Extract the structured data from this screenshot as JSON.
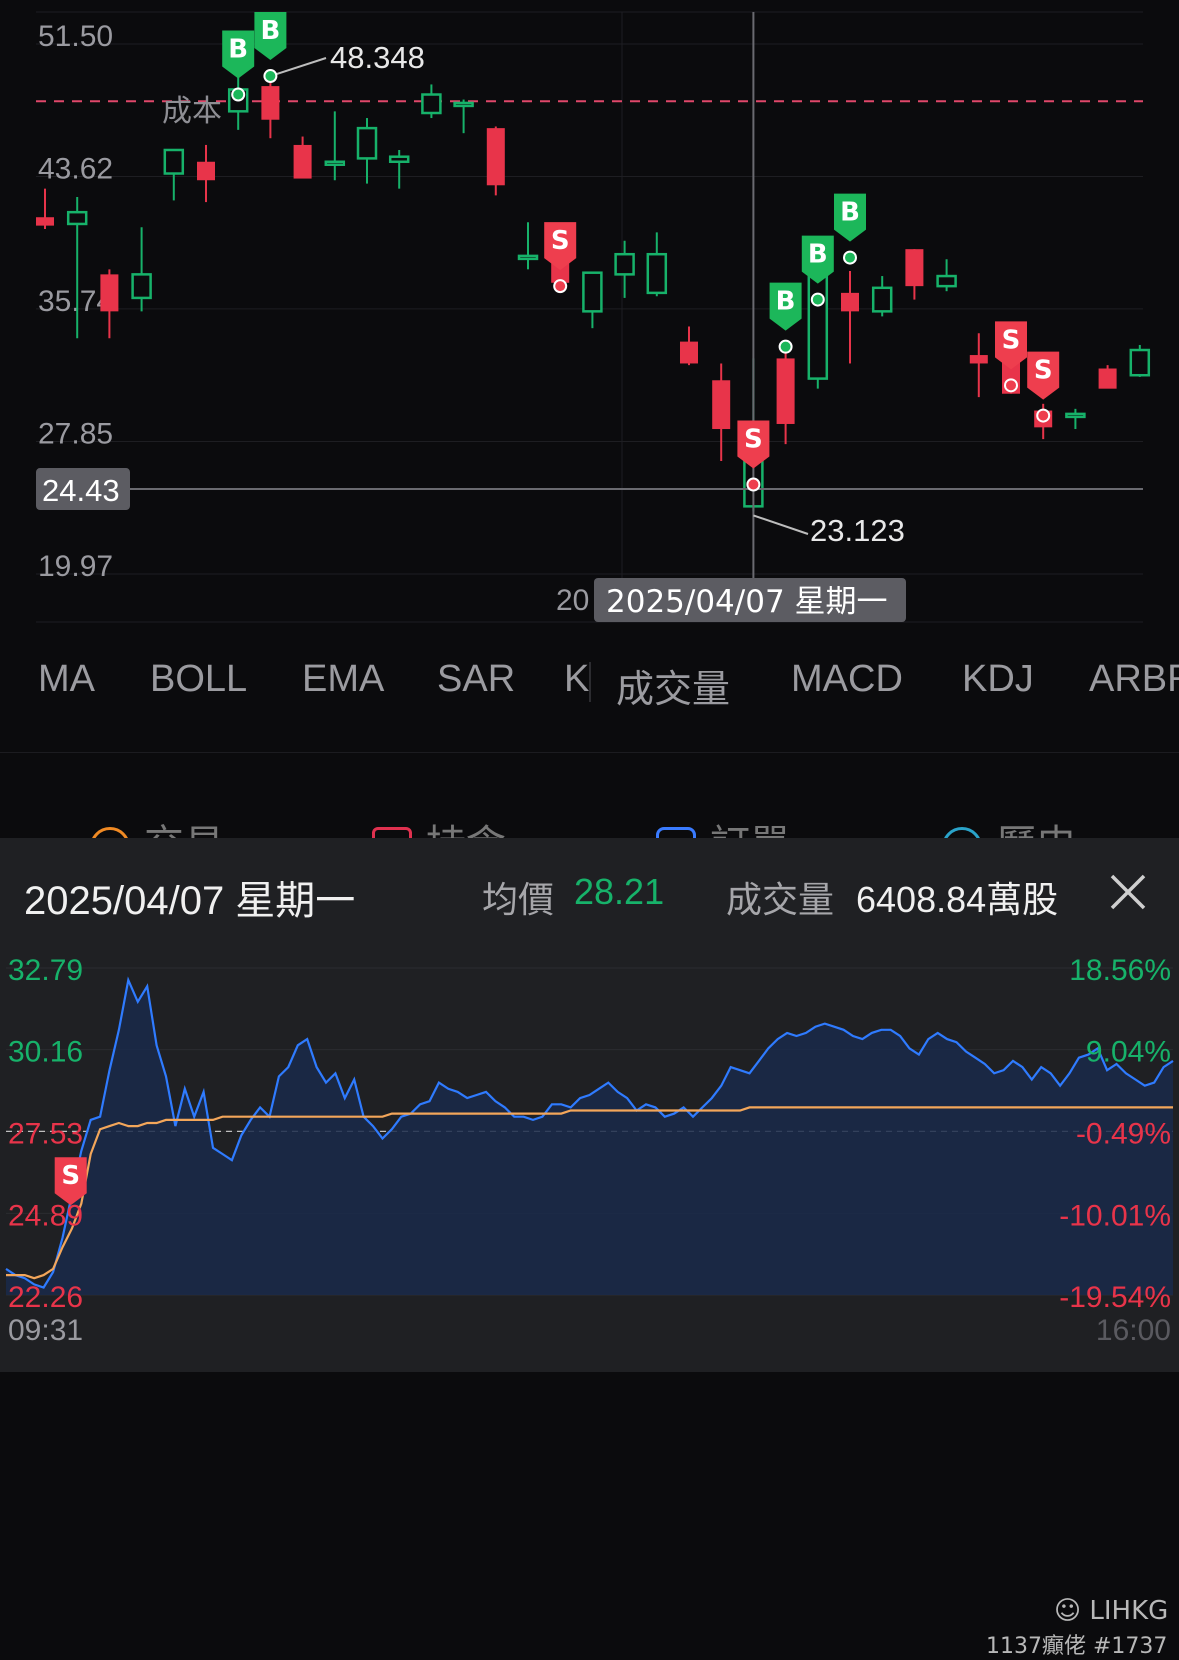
{
  "kchart": {
    "price_labels": [
      "51.50",
      "43.62",
      "35.74",
      "27.85",
      "19.97"
    ],
    "cost_label": "成本",
    "crosshair_price": "24.43",
    "crosshair_date": "2025/04/07 星期一",
    "date_label_partial": "20",
    "high_label": "48.348",
    "low_label": "23.123",
    "buy_marker": "B",
    "sell_marker": "S"
  },
  "tabs": [
    "MA",
    "BOLL",
    "EMA",
    "SAR",
    "K",
    "成交量",
    "MACD",
    "KDJ",
    "ARBR"
  ],
  "ghost_tabs": [
    {
      "label": "交易",
      "color": "#f08a24"
    },
    {
      "label": "持倉",
      "color": "#e0314f"
    },
    {
      "label": "訂單",
      "color": "#3a7bff"
    },
    {
      "label": "歷史",
      "color": "#2aa3c9"
    }
  ],
  "panel": {
    "date": "2025/04/07 星期一",
    "avg_label": "均價",
    "avg_value": "28.21",
    "volume_label": "成交量",
    "volume_value": "6408.84萬股",
    "left_axis": [
      "32.79",
      "30.16",
      "27.53",
      "24.89",
      "22.26"
    ],
    "right_axis": [
      "18.56%",
      "9.04%",
      "-0.49%",
      "-10.01%",
      "-19.54%"
    ],
    "time_start": "09:31",
    "time_end": "16:00",
    "watermark_brand": "LIHKG",
    "watermark_user": "1137癲佬 #1737"
  },
  "colors": {
    "up": "#17b26a",
    "down": "#e8344a",
    "price_line": "#2f7bff",
    "avg_line": "#f3a65a",
    "cost_line": "#e0476a",
    "background": "#0b0b0d",
    "panel_bg": "#1f2023"
  },
  "chart_data": [
    {
      "type": "candlestick",
      "title": "",
      "ylim": [
        19.97,
        51.5
      ],
      "yticks": [
        51.5,
        43.62,
        35.74,
        27.85,
        19.97
      ],
      "cost_price": 47.5,
      "crosshair": {
        "date": "2025/04/07",
        "price": 24.43
      },
      "annotations": [
        {
          "label": "48.348",
          "kind": "high"
        },
        {
          "label": "23.123",
          "kind": "low"
        }
      ],
      "candles": [
        {
          "o": 40.6,
          "h": 42.3,
          "l": 39.9,
          "c": 40.1
        },
        {
          "o": 40.2,
          "h": 41.8,
          "l": 33.4,
          "c": 40.9
        },
        {
          "o": 37.2,
          "h": 37.5,
          "l": 33.4,
          "c": 35.0
        },
        {
          "o": 35.8,
          "h": 40.0,
          "l": 35.0,
          "c": 37.2
        },
        {
          "o": 43.2,
          "h": 44.1,
          "l": 41.6,
          "c": 44.6
        },
        {
          "o": 43.9,
          "h": 44.9,
          "l": 41.5,
          "c": 42.8
        },
        {
          "o": 46.9,
          "h": 50.1,
          "l": 45.8,
          "c": 48.2
        },
        {
          "o": 48.4,
          "h": 49.0,
          "l": 45.3,
          "c": 46.4
        },
        {
          "o": 44.9,
          "h": 45.4,
          "l": 43.0,
          "c": 42.9
        },
        {
          "o": 43.9,
          "h": 46.9,
          "l": 42.8,
          "c": 43.9
        },
        {
          "o": 44.1,
          "h": 46.5,
          "l": 42.6,
          "c": 45.9
        },
        {
          "o": 43.9,
          "h": 44.6,
          "l": 42.3,
          "c": 44.2
        },
        {
          "o": 46.8,
          "h": 48.5,
          "l": 46.5,
          "c": 47.9
        },
        {
          "o": 47.4,
          "h": 47.6,
          "l": 45.6,
          "c": 47.4
        },
        {
          "o": 45.9,
          "h": 46.0,
          "l": 41.9,
          "c": 42.5
        },
        {
          "o": 38.3,
          "h": 40.3,
          "l": 37.5,
          "c": 38.3
        },
        {
          "o": 38.1,
          "h": 38.5,
          "l": 36.4,
          "c": 36.7
        },
        {
          "o": 35.0,
          "h": 37.1,
          "l": 34.0,
          "c": 37.3
        },
        {
          "o": 37.2,
          "h": 39.2,
          "l": 35.8,
          "c": 38.4
        },
        {
          "o": 36.1,
          "h": 39.7,
          "l": 35.9,
          "c": 38.4
        },
        {
          "o": 33.2,
          "h": 34.1,
          "l": 31.8,
          "c": 31.9
        },
        {
          "o": 30.9,
          "h": 31.9,
          "l": 26.1,
          "c": 28.0
        },
        {
          "o": 23.4,
          "h": 32.2,
          "l": 23.1,
          "c": 28.3
        },
        {
          "o": 32.2,
          "h": 33.2,
          "l": 27.1,
          "c": 28.3
        },
        {
          "o": 31.0,
          "h": 39.0,
          "l": 30.4,
          "c": 38.7
        },
        {
          "o": 36.1,
          "h": 37.4,
          "l": 31.9,
          "c": 35.0
        },
        {
          "o": 35.0,
          "h": 37.1,
          "l": 34.7,
          "c": 36.4
        },
        {
          "o": 38.7,
          "h": 38.7,
          "l": 35.7,
          "c": 36.5
        },
        {
          "o": 36.5,
          "h": 38.1,
          "l": 36.2,
          "c": 37.1
        },
        {
          "o": 32.4,
          "h": 33.7,
          "l": 29.9,
          "c": 31.9
        },
        {
          "o": 32.0,
          "h": 32.6,
          "l": 30.1,
          "c": 30.1
        },
        {
          "o": 29.1,
          "h": 29.5,
          "l": 27.4,
          "c": 28.1
        },
        {
          "o": 28.9,
          "h": 29.2,
          "l": 28.0,
          "c": 28.9
        },
        {
          "o": 31.6,
          "h": 31.8,
          "l": 30.6,
          "c": 30.4
        },
        {
          "o": 31.2,
          "h": 33.0,
          "l": 31.1,
          "c": 32.7
        }
      ],
      "trades": [
        {
          "candle": 6,
          "side": "B",
          "price": 47.9
        },
        {
          "candle": 7,
          "side": "B",
          "price": 49.0
        },
        {
          "candle": 16,
          "side": "S",
          "price": 36.5
        },
        {
          "candle": 22,
          "side": "S",
          "price": 24.7
        },
        {
          "candle": 23,
          "side": "B",
          "price": 32.9
        },
        {
          "candle": 24,
          "side": "B",
          "price": 35.7
        },
        {
          "candle": 25,
          "side": "B",
          "price": 38.2
        },
        {
          "candle": 30,
          "side": "S",
          "price": 30.6
        },
        {
          "candle": 31,
          "side": "S",
          "price": 28.8
        }
      ]
    },
    {
      "type": "line",
      "title": "",
      "x_range": [
        "09:31",
        "16:00"
      ],
      "ylim": [
        22.26,
        32.79
      ],
      "yticks": [
        32.79,
        30.16,
        27.53,
        24.89,
        22.26
      ],
      "pct_ticks": [
        "18.56%",
        "9.04%",
        "-0.49%",
        "-10.01%",
        "-19.54%"
      ],
      "reference": 27.53,
      "series": [
        {
          "color": "#2f7bff",
          "values": [
            23.1,
            22.9,
            22.8,
            22.6,
            22.5,
            23.0,
            24.1,
            25.5,
            26.9,
            27.9,
            28.0,
            29.5,
            30.8,
            32.4,
            31.7,
            32.2,
            30.3,
            29.3,
            27.7,
            28.9,
            28.0,
            28.8,
            27.0,
            26.8,
            26.6,
            27.4,
            27.9,
            28.3,
            28.0,
            29.3,
            29.6,
            30.3,
            30.5,
            29.6,
            29.1,
            29.4,
            28.6,
            29.2,
            28.0,
            27.7,
            27.3,
            27.6,
            28.0,
            28.1,
            28.4,
            28.5,
            29.1,
            28.9,
            28.8,
            28.6,
            28.7,
            28.8,
            28.5,
            28.3,
            28.0,
            28.0,
            27.9,
            28.0,
            28.4,
            28.4,
            28.3,
            28.6,
            28.7,
            28.9,
            29.1,
            28.8,
            28.6,
            28.2,
            28.4,
            28.3,
            28.0,
            28.1,
            28.3,
            28.0,
            28.3,
            28.6,
            29.0,
            29.6,
            29.5,
            29.4,
            29.8,
            30.2,
            30.5,
            30.7,
            30.6,
            30.7,
            30.9,
            31.0,
            30.9,
            30.8,
            30.6,
            30.5,
            30.7,
            30.8,
            30.8,
            30.6,
            30.2,
            30.0,
            30.5,
            30.7,
            30.5,
            30.4,
            30.1,
            29.9,
            29.7,
            29.4,
            29.5,
            29.8,
            29.6,
            29.2,
            29.6,
            29.4,
            29.0,
            29.4,
            29.9,
            30.0,
            30.2,
            29.5,
            29.7,
            29.4,
            29.2,
            29.0,
            29.1,
            29.6,
            29.8
          ]
        },
        {
          "color": "#f3a65a",
          "values": [
            22.9,
            22.9,
            22.9,
            22.8,
            22.9,
            23.1,
            23.8,
            24.4,
            25.2,
            26.8,
            27.6,
            27.7,
            27.8,
            27.7,
            27.7,
            27.8,
            27.8,
            27.9,
            27.9,
            27.9,
            27.9,
            27.9,
            27.9,
            28.0,
            28.0,
            28.0,
            28.0,
            28.0,
            28.0,
            28.0,
            28.0,
            28.0,
            28.0,
            28.0,
            28.0,
            28.0,
            28.0,
            28.0,
            28.0,
            28.0,
            28.0,
            28.1,
            28.1,
            28.1,
            28.1,
            28.1,
            28.1,
            28.1,
            28.1,
            28.1,
            28.1,
            28.1,
            28.1,
            28.1,
            28.1,
            28.1,
            28.1,
            28.1,
            28.1,
            28.1,
            28.2,
            28.2,
            28.2,
            28.2,
            28.2,
            28.2,
            28.2,
            28.2,
            28.2,
            28.2,
            28.2,
            28.2,
            28.2,
            28.2,
            28.2,
            28.2,
            28.2,
            28.2,
            28.2,
            28.3,
            28.3,
            28.3,
            28.3,
            28.3,
            28.3,
            28.3,
            28.3,
            28.3,
            28.3,
            28.3,
            28.3,
            28.3,
            28.3,
            28.3,
            28.3,
            28.3,
            28.3,
            28.3,
            28.3,
            28.3,
            28.3,
            28.3,
            28.3,
            28.3,
            28.3,
            28.3,
            28.3,
            28.3,
            28.3,
            28.3,
            28.3,
            28.3,
            28.3,
            28.3,
            28.3,
            28.3,
            28.3,
            28.3,
            28.3,
            28.3,
            28.3,
            28.3,
            28.3,
            28.3,
            28.3
          ]
        }
      ],
      "trades": [
        {
          "index": 9,
          "side": "S",
          "price": 24.7
        }
      ]
    }
  ]
}
